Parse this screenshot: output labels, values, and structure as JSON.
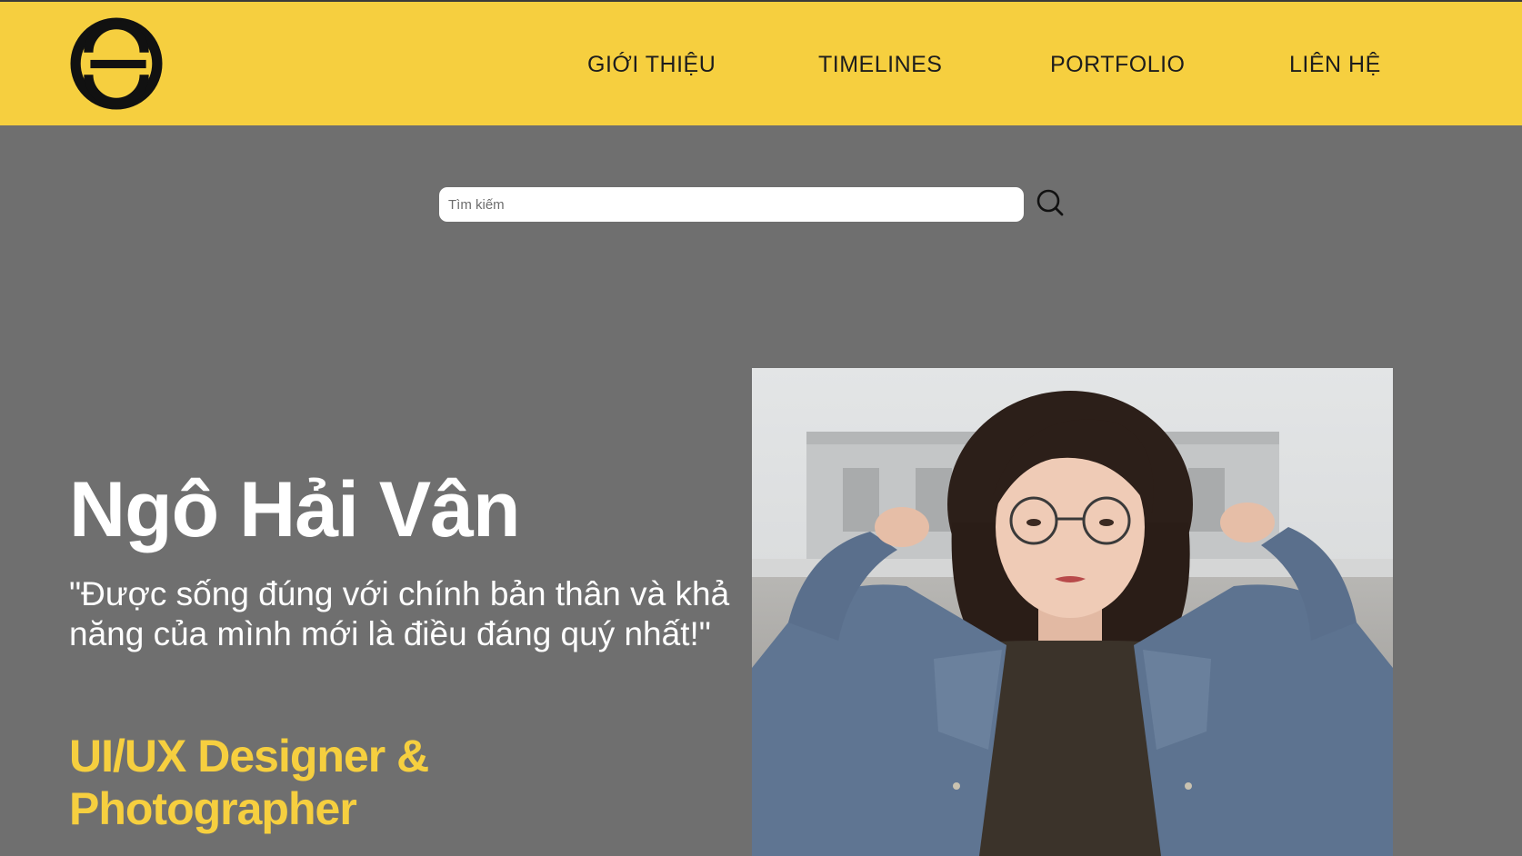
{
  "brand": {
    "logo_icon": "circular-s-logo-icon"
  },
  "nav": {
    "items": [
      {
        "label": "GIỚI THIỆU"
      },
      {
        "label": "TIMELINES"
      },
      {
        "label": "PORTFOLIO"
      },
      {
        "label": "LIÊN HỆ"
      }
    ]
  },
  "search": {
    "placeholder": "Tìm kiếm",
    "value": "",
    "icon": "search-icon"
  },
  "hero": {
    "name": "Ngô Hải Vân",
    "quote": "\"Được sống đúng với chính bản thân và khả năng của mình mới là điều đáng quý nhất!\"",
    "role": "UI/UX Designer & Photographer"
  },
  "colors": {
    "accent": "#f6cf3f",
    "background": "#6f6f6f",
    "nav_text": "#1d1d1d",
    "hero_text": "#ffffff"
  }
}
